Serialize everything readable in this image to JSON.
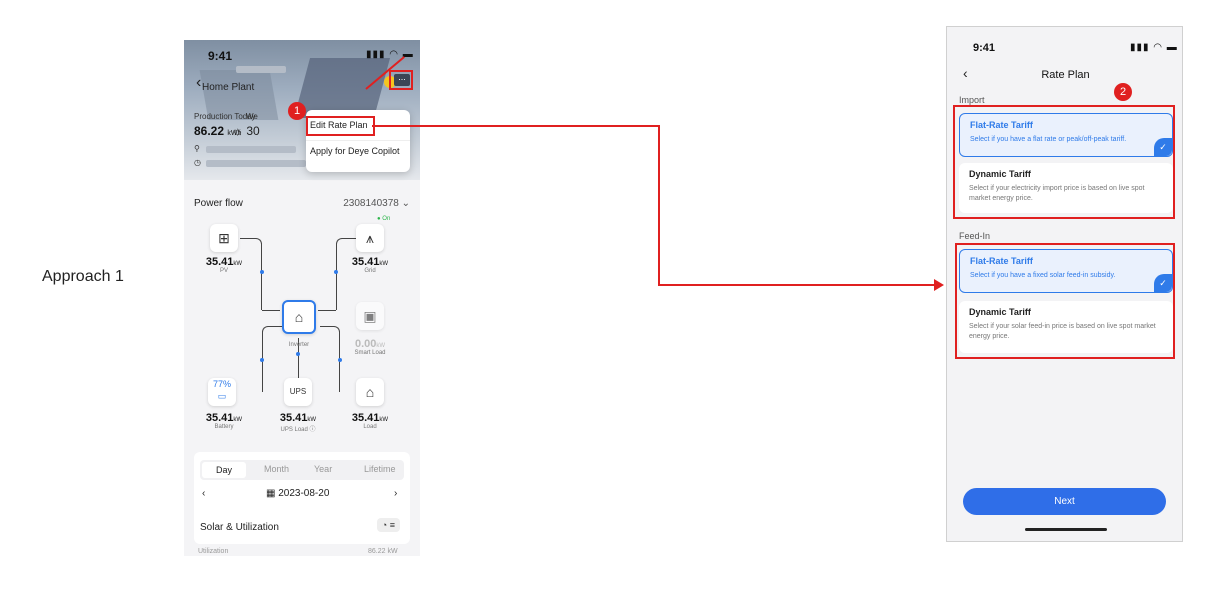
{
  "approach_label": "Approach 1",
  "left_phone": {
    "status_time": "9:41",
    "plant_name": "Home Plant",
    "production_label": "Production Today",
    "weather_label": "We",
    "production_value": "86.22",
    "production_unit": "kWh",
    "temperature": "☼ 30",
    "menu": {
      "items": [
        "Edit Rate Plan",
        "Apply for Deye Copilot"
      ]
    },
    "step_badge": "1",
    "power_flow_label": "Power flow",
    "serial_number": "2308140378",
    "grid_status": "On",
    "nodes": {
      "pv": {
        "value": "35.41",
        "unit": "kW",
        "name": "PV"
      },
      "grid": {
        "value": "35.41",
        "unit": "kW",
        "name": "Grid"
      },
      "inverter": {
        "name": "Inverter"
      },
      "smart_load": {
        "value": "0.00",
        "unit": "kW",
        "name": "Smart Load"
      },
      "battery": {
        "percent": "77%",
        "value": "35.41",
        "unit": "kW",
        "name": "Battery"
      },
      "ups": {
        "value": "35.41",
        "unit": "kW",
        "name": "UPS Load"
      },
      "load": {
        "value": "35.41",
        "unit": "kW",
        "name": "Load"
      }
    },
    "period_tabs": [
      "Day",
      "Month",
      "Year",
      "Lifetime"
    ],
    "date": "2023-08-20",
    "solar_title": "Solar & Utilization",
    "utilization_label": "Utilization",
    "utilization_value": "86.22 kW"
  },
  "right_phone": {
    "status_time": "9:41",
    "title": "Rate Plan",
    "step_badge": "2",
    "import_label": "Import",
    "import_options": [
      {
        "title": "Flat-Rate Tariff",
        "desc": "Select if you have a flat rate or peak/off-peak tariff.",
        "selected": true
      },
      {
        "title": "Dynamic Tariff",
        "desc": "Select if your electricity import price is based on live spot market energy price.",
        "selected": false
      }
    ],
    "feedin_label": "Feed-In",
    "feedin_options": [
      {
        "title": "Flat-Rate Tariff",
        "desc": "Select if you have a fixed solar feed-in subsidy.",
        "selected": true
      },
      {
        "title": "Dynamic Tariff",
        "desc": "Select if your solar feed-in price is based on live spot market energy price.",
        "selected": false
      }
    ],
    "next_label": "Next"
  },
  "colors": {
    "accent": "#2f7be9",
    "highlight": "#e02020",
    "online": "#2cb54a"
  }
}
